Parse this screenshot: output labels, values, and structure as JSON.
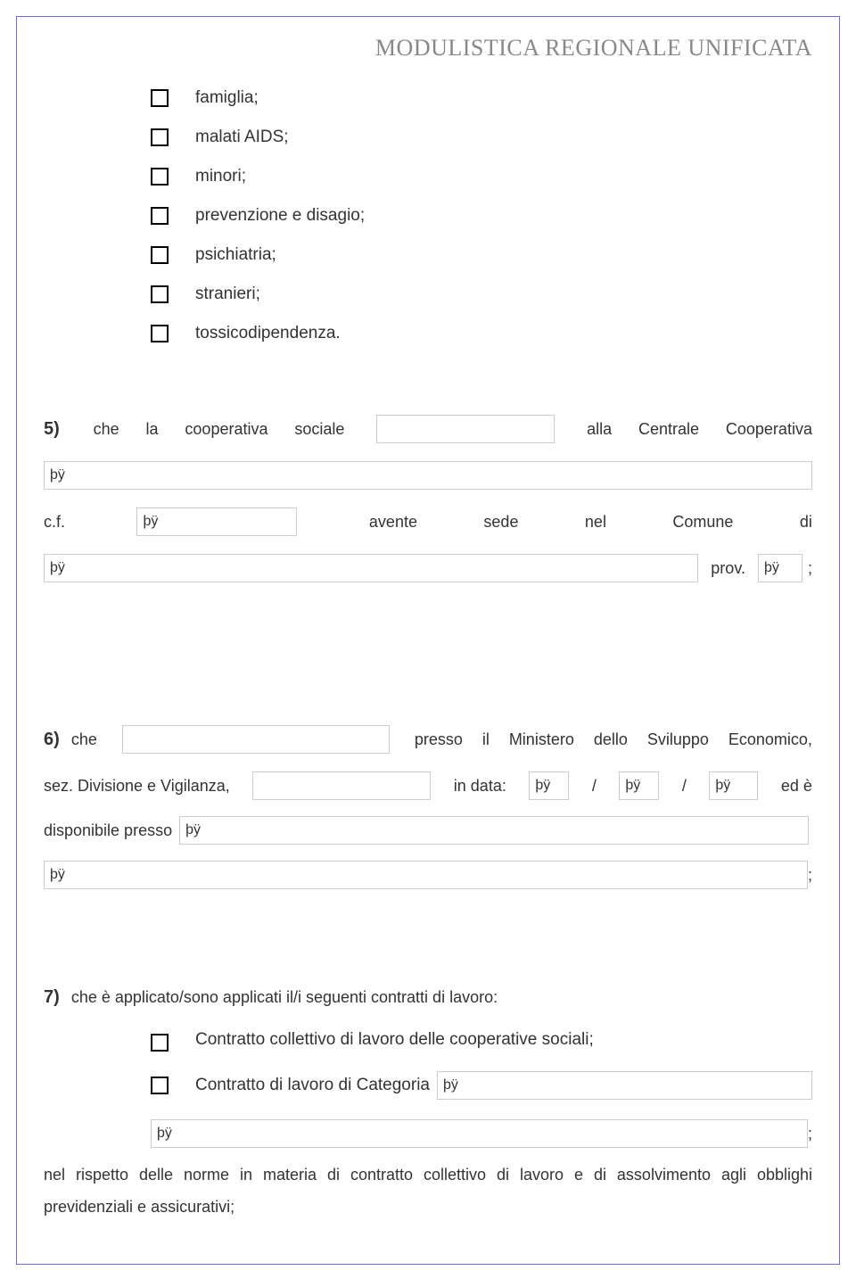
{
  "header": {
    "title": "MODULISTICA REGIONALE UNIFICATA"
  },
  "checkboxes_top": {
    "items": [
      "famiglia;",
      "malati AIDS;",
      "minori;",
      "prevenzione e disagio;",
      "psichiatria;",
      "stranieri;",
      "tossicodipendenza."
    ]
  },
  "section5": {
    "num": "5)",
    "t1": "che",
    "t2": "la",
    "t3": "cooperativa",
    "t4": "sociale",
    "field1": "",
    "t5": "alla",
    "t6": "Centrale",
    "t7": "Cooperativa",
    "field_wide1": "þÿ",
    "t8": "c.f.",
    "field_cf": "þÿ",
    "t9": "avente",
    "t10": "sede",
    "t11": "nel",
    "t12": "Comune",
    "t13": "di",
    "field_comune": "þÿ",
    "t14": "prov.",
    "field_prov": "þÿ",
    "t15": ";"
  },
  "section6": {
    "num": "6)",
    "t1": "che",
    "field1": "",
    "t2": "presso",
    "t3": "il",
    "t4": "Ministero",
    "t5": "dello",
    "t6": "Sviluppo",
    "t7": "Economico,",
    "t8": "sez. Divisione e Vigilanza,",
    "field2": "",
    "t9": "in data:",
    "field_d1": "þÿ",
    "slash1": "/",
    "field_d2": "þÿ",
    "slash2": "/",
    "field_d3": "þÿ",
    "t10": "ed è",
    "t11": "disponibile presso",
    "field3": "þÿ",
    "field4": "þÿ",
    "t12": ";"
  },
  "section7": {
    "num": "7)",
    "t1": "che è applicato/sono applicati il/i seguenti contratti di lavoro:",
    "cb1": "Contratto collettivo di lavoro delle cooperative sociali;",
    "cb2": "Contratto di lavoro di Categoria",
    "field_cat": "þÿ",
    "field_full": "þÿ",
    "semi": ";",
    "para": "nel rispetto delle norme in materia di contratto collettivo di lavoro e di assolvimento agli obblighi previdenziali e assicurativi;"
  },
  "placeholder": "þÿ"
}
